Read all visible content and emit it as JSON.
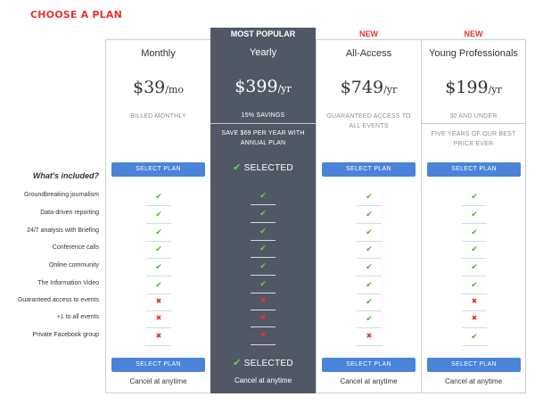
{
  "page_title": "CHOOSE A PLAN",
  "features_title": "What's included?",
  "features": [
    "Groundbreaking journalism",
    "Data-driven reporting",
    "24/7 analysis with Briefing",
    "Conference calls",
    "Online community",
    "The Information Video",
    "Guaranteed access to events",
    "+1 to all events",
    "Private Facebook group"
  ],
  "plans": [
    {
      "tag": "",
      "name": "Monthly",
      "price": "$39",
      "per": "/mo",
      "note": "BILLED MONTHLY",
      "subnote": "",
      "button": "SELECT PLAN",
      "selected": false,
      "included": [
        true,
        true,
        true,
        true,
        true,
        true,
        false,
        false,
        false
      ],
      "cancel": "Cancel at anytime"
    },
    {
      "tag": "MOST POPULAR",
      "name": "Yearly",
      "price": "$399",
      "per": "/yr",
      "note": "15% SAVINGS",
      "subnote": "SAVE $69 PER YEAR WITH ANNUAL PLAN",
      "button": "SELECTED",
      "selected": true,
      "included": [
        true,
        true,
        true,
        true,
        true,
        true,
        false,
        false,
        false
      ],
      "cancel": "Cancel at anytime"
    },
    {
      "tag": "NEW",
      "name": "All-Access",
      "price": "$749",
      "per": "/yr",
      "note": "GUARANTEED ACCESS TO ALL EVENTS",
      "subnote": "",
      "button": "SELECT PLAN",
      "selected": false,
      "included": [
        true,
        true,
        true,
        true,
        true,
        true,
        true,
        true,
        false
      ],
      "cancel": "Cancel at anytime"
    },
    {
      "tag": "NEW",
      "name": "Young Professionals",
      "price": "$199",
      "per": "/yr",
      "note": "30 AND UNDER",
      "subnote": "FIVE YEARS OF OUR BEST PRICE EVER",
      "button": "SELECT PLAN",
      "selected": false,
      "included": [
        true,
        true,
        true,
        true,
        true,
        true,
        false,
        false,
        true
      ],
      "cancel": "Cancel at anytime"
    }
  ],
  "icons": {
    "check": "check-icon",
    "cross": "cross-icon"
  },
  "colors": {
    "accent_red": "#e8322e",
    "button_blue": "#4a83d8",
    "highlight_bg": "#515865",
    "check_green": "#4caf2e"
  }
}
